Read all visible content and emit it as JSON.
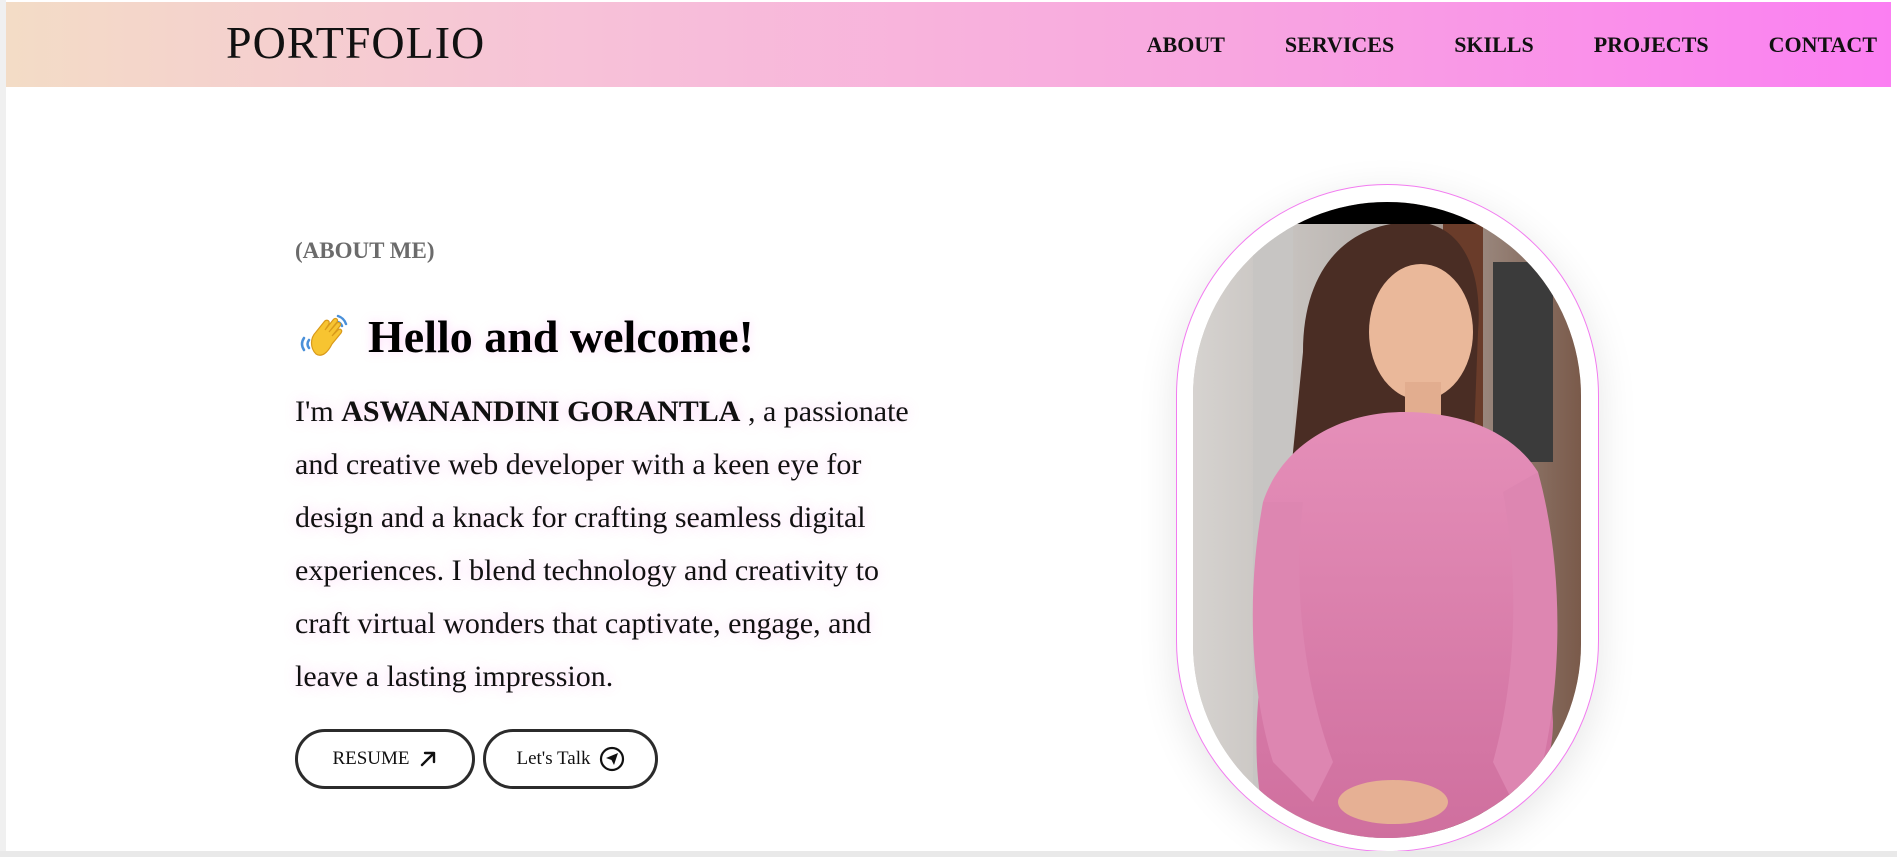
{
  "header": {
    "brand": "PORTFOLIO",
    "nav": [
      "ABOUT",
      "SERVICES",
      "SKILLS",
      "PROJECTS",
      "CONTACT"
    ]
  },
  "hero": {
    "section_label": "(ABOUT ME)",
    "greeting_icon": "waving-hand-icon",
    "greeting": "Hello and welcome!",
    "bio_prefix": "I'm",
    "name": "ASWANANDINI GORANTLA",
    "bio_rest": ", a passionate and creative web developer with a keen eye for design and a knack for crafting seamless digital experiences. I blend technology and creativity to craft virtual wonders that captivate, engage, and leave a lasting impression."
  },
  "buttons": {
    "resume_label": "RESUME",
    "resume_icon": "arrow-up-right-icon",
    "talk_label": "Let's Talk",
    "talk_icon": "send-circle-icon"
  },
  "profile": {
    "photo_icon": "profile-photo"
  },
  "colors": {
    "header_gradient_start": "#f3dcc6",
    "header_gradient_end": "#fb7ff2",
    "photo_border": "#f27bf0",
    "label_gray": "#6b6b6b"
  }
}
